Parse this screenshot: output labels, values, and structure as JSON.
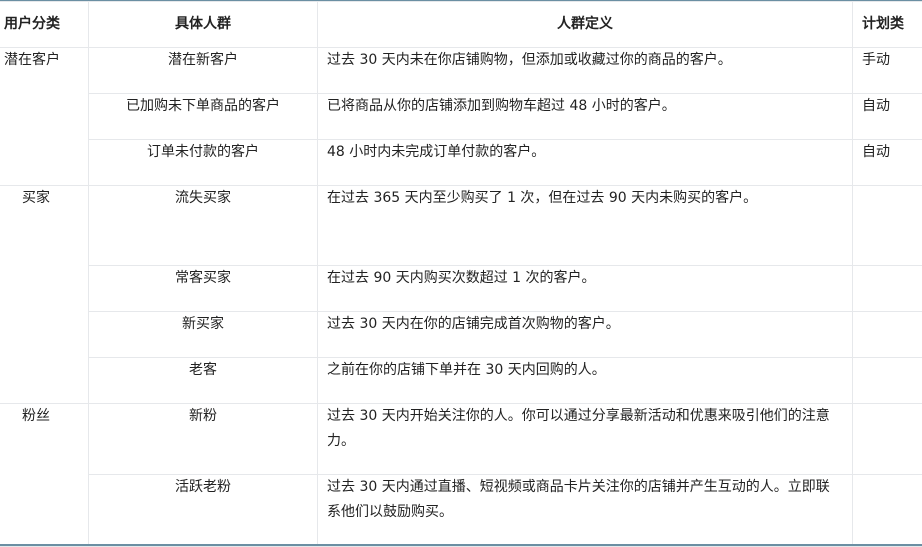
{
  "table": {
    "headers": {
      "category": "用户分类",
      "group": "具体人群",
      "definition": "人群定义",
      "plan": "计划类"
    },
    "rows": [
      {
        "category": "潜在客户",
        "group": "潜在新客户",
        "definition": "过去 30 天内未在你店铺购物，但添加或收藏过你的商品的客户。",
        "plan": "手动"
      },
      {
        "category": "",
        "group": "已加购未下单商品的客户",
        "definition": "已将商品从你的店铺添加到购物车超过 48 小时的客户。",
        "plan": "自动"
      },
      {
        "category": "",
        "group": "订单未付款的客户",
        "definition": "48 小时内未完成订单付款的客户。",
        "plan": "自动"
      },
      {
        "category": "买家",
        "group": "流失买家",
        "definition": "在过去 365 天内至少购买了 1 次，但在过去 90 天内未购买的客户。",
        "plan": ""
      },
      {
        "category": "",
        "group": "常客买家",
        "definition": "在过去 90 天内购买次数超过 1 次的客户。",
        "plan": ""
      },
      {
        "category": "",
        "group": "新买家",
        "definition": "过去 30 天内在你的店铺完成首次购物的客户。",
        "plan": ""
      },
      {
        "category": "",
        "group": "老客",
        "definition": "之前在你的店铺下单并在 30 天内回购的人。",
        "plan": ""
      },
      {
        "category": "粉丝",
        "group": "新粉",
        "definition": "过去 30 天内开始关注你的人。你可以通过分享最新活动和优惠来吸引他们的注意力。",
        "plan": ""
      },
      {
        "category": "",
        "group": "活跃老粉",
        "definition": "过去 30 天内通过直播、短视频或商品卡片关注你的店铺并产生互动的人。立即联系他们以鼓励购买。",
        "plan": ""
      }
    ]
  }
}
